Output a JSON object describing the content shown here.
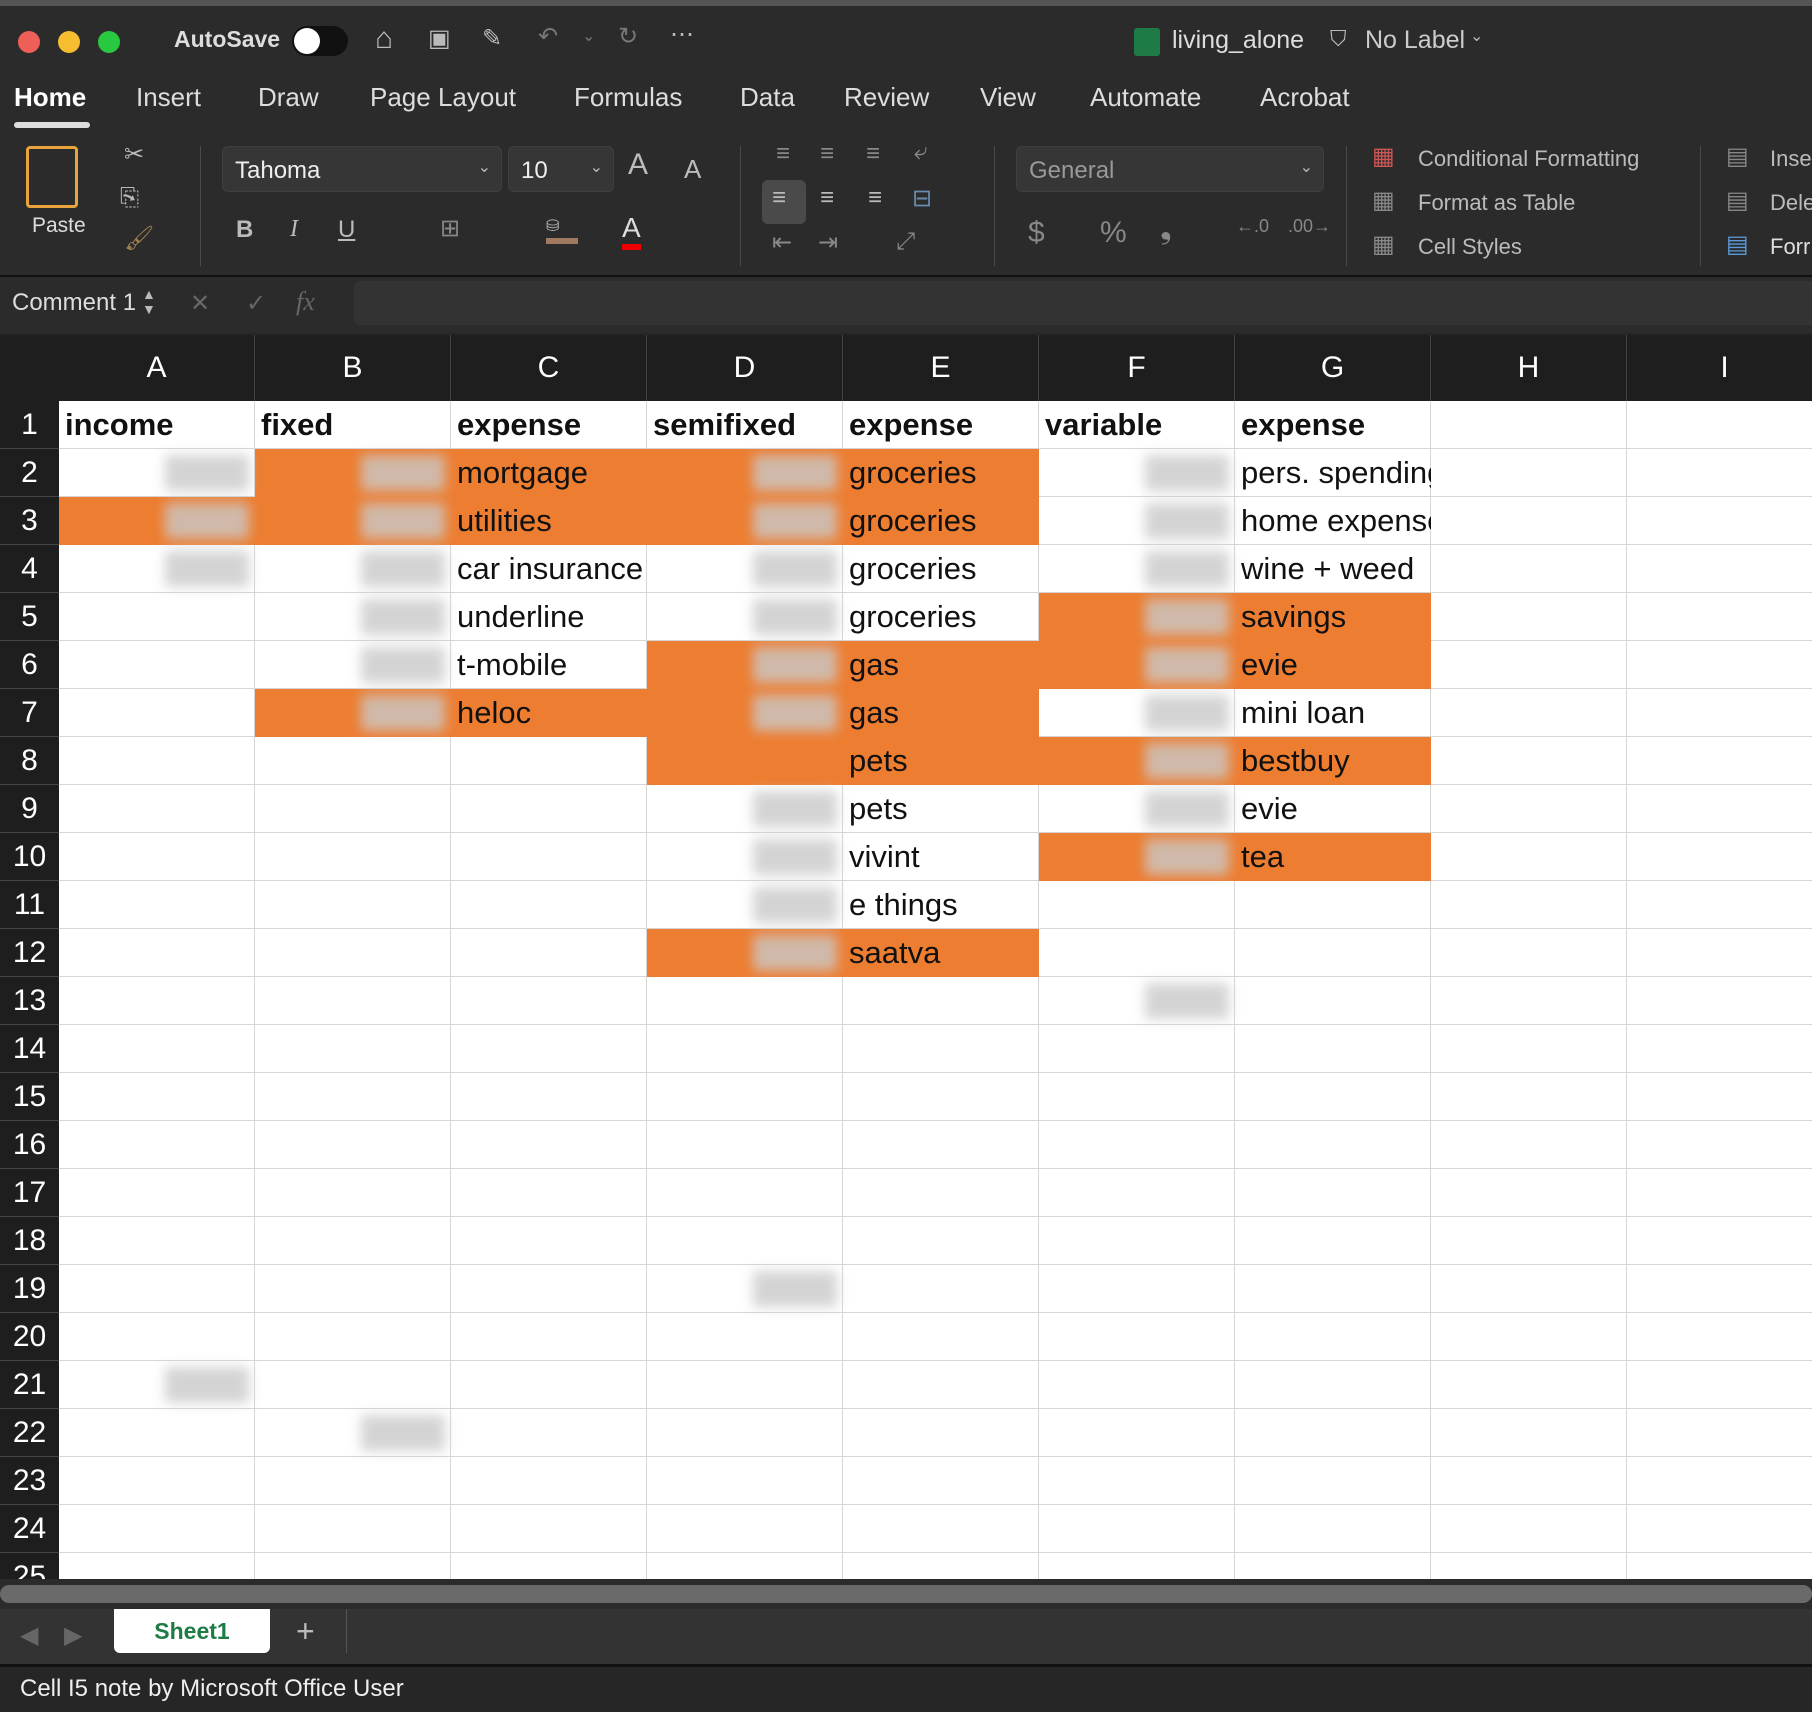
{
  "window": {
    "autosave_label": "AutoSave",
    "file_name": "living_alone",
    "label": "No Label"
  },
  "tabs": [
    "Home",
    "Insert",
    "Draw",
    "Page Layout",
    "Formulas",
    "Data",
    "Review",
    "View",
    "Automate",
    "Acrobat"
  ],
  "active_tab": "Home",
  "ribbon": {
    "paste": "Paste",
    "font_name": "Tahoma",
    "font_size": "10",
    "bold": "B",
    "italic": "I",
    "underline": "U",
    "number_format": "General",
    "currency": "$",
    "percent": "%",
    "comma": "❟",
    "conditional_formatting": "Conditional Formatting",
    "format_as_table": "Format as Table",
    "cell_styles": "Cell Styles",
    "insert": "Inse",
    "delete": "Dele",
    "format": "Forr",
    "grow_font": "A",
    "shrink_font": "A",
    "font_color": "A"
  },
  "formula_bar": {
    "name_box": "Comment 1",
    "fx": "fx",
    "value": ""
  },
  "columns": [
    "A",
    "B",
    "C",
    "D",
    "E",
    "F",
    "G",
    "H",
    "I"
  ],
  "row_count": 25,
  "colors": {
    "accent_fill": "#ED7D31",
    "sheet_tab_text": "#1E7B45"
  },
  "cells": [
    {
      "r": 1,
      "c": 0,
      "v": "income",
      "b": true
    },
    {
      "r": 1,
      "c": 1,
      "v": "fixed",
      "b": true
    },
    {
      "r": 1,
      "c": 2,
      "v": "expense",
      "b": true
    },
    {
      "r": 1,
      "c": 3,
      "v": "semifixed",
      "b": true
    },
    {
      "r": 1,
      "c": 4,
      "v": "expense",
      "b": true
    },
    {
      "r": 1,
      "c": 5,
      "v": "variable",
      "b": true
    },
    {
      "r": 1,
      "c": 6,
      "v": "expense",
      "b": true
    },
    {
      "r": 2,
      "c": 2,
      "v": "mortgage"
    },
    {
      "r": 2,
      "c": 4,
      "v": "groceries"
    },
    {
      "r": 2,
      "c": 6,
      "v": "pers. spending"
    },
    {
      "r": 3,
      "c": 2,
      "v": "utilities"
    },
    {
      "r": 3,
      "c": 4,
      "v": "groceries"
    },
    {
      "r": 3,
      "c": 6,
      "v": "home expenses"
    },
    {
      "r": 4,
      "c": 2,
      "v": "car insurance"
    },
    {
      "r": 4,
      "c": 4,
      "v": "groceries"
    },
    {
      "r": 4,
      "c": 6,
      "v": "wine + weed"
    },
    {
      "r": 5,
      "c": 2,
      "v": "underline"
    },
    {
      "r": 5,
      "c": 4,
      "v": "groceries"
    },
    {
      "r": 5,
      "c": 6,
      "v": "savings"
    },
    {
      "r": 6,
      "c": 2,
      "v": "t-mobile"
    },
    {
      "r": 6,
      "c": 4,
      "v": "gas"
    },
    {
      "r": 6,
      "c": 6,
      "v": "evie"
    },
    {
      "r": 7,
      "c": 2,
      "v": "heloc"
    },
    {
      "r": 7,
      "c": 4,
      "v": "gas"
    },
    {
      "r": 7,
      "c": 6,
      "v": "mini loan"
    },
    {
      "r": 8,
      "c": 4,
      "v": "pets"
    },
    {
      "r": 8,
      "c": 6,
      "v": "bestbuy"
    },
    {
      "r": 9,
      "c": 4,
      "v": "pets"
    },
    {
      "r": 9,
      "c": 6,
      "v": "evie"
    },
    {
      "r": 10,
      "c": 4,
      "v": "vivint"
    },
    {
      "r": 10,
      "c": 6,
      "v": "tea"
    },
    {
      "r": 11,
      "c": 4,
      "v": "e things"
    },
    {
      "r": 12,
      "c": 4,
      "v": "saatva"
    }
  ],
  "fills": [
    [
      2,
      1
    ],
    [
      2,
      2
    ],
    [
      2,
      3
    ],
    [
      2,
      4
    ],
    [
      3,
      0
    ],
    [
      3,
      1
    ],
    [
      3,
      2
    ],
    [
      3,
      3
    ],
    [
      3,
      4
    ],
    [
      5,
      5
    ],
    [
      5,
      6
    ],
    [
      6,
      3
    ],
    [
      6,
      4
    ],
    [
      6,
      5
    ],
    [
      6,
      6
    ],
    [
      7,
      1
    ],
    [
      7,
      2
    ],
    [
      7,
      3
    ],
    [
      7,
      4
    ],
    [
      8,
      3
    ],
    [
      8,
      4
    ],
    [
      8,
      5
    ],
    [
      8,
      6
    ],
    [
      10,
      5
    ],
    [
      10,
      6
    ],
    [
      12,
      3
    ],
    [
      12,
      4
    ]
  ],
  "redacted": [
    [
      2,
      0
    ],
    [
      3,
      0
    ],
    [
      4,
      0
    ],
    [
      2,
      1
    ],
    [
      3,
      1
    ],
    [
      4,
      1
    ],
    [
      5,
      1
    ],
    [
      6,
      1
    ],
    [
      7,
      1
    ],
    [
      2,
      3
    ],
    [
      3,
      3
    ],
    [
      4,
      3
    ],
    [
      5,
      3
    ],
    [
      6,
      3
    ],
    [
      7,
      3
    ],
    [
      9,
      3
    ],
    [
      10,
      3
    ],
    [
      11,
      3
    ],
    [
      12,
      3
    ],
    [
      2,
      5
    ],
    [
      3,
      5
    ],
    [
      4,
      5
    ],
    [
      5,
      5
    ],
    [
      6,
      5
    ],
    [
      7,
      5
    ],
    [
      8,
      5
    ],
    [
      9,
      5
    ],
    [
      10,
      5
    ],
    [
      13,
      5
    ],
    [
      19,
      3
    ],
    [
      21,
      0
    ],
    [
      22,
      1
    ]
  ],
  "sheet_tab": "Sheet1",
  "add_sheet": "+",
  "status": "Cell I5 note by Microsoft Office User"
}
